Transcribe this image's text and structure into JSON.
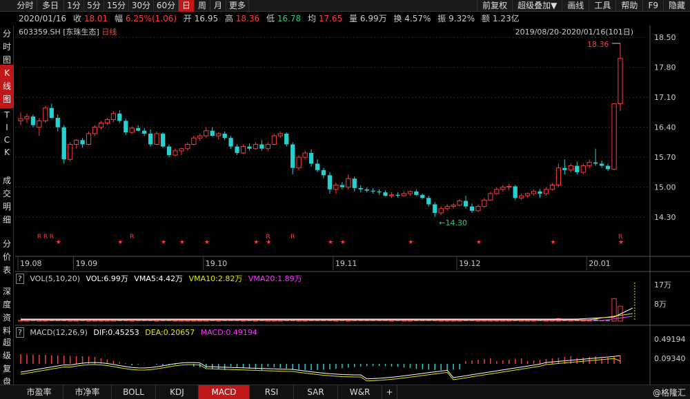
{
  "periods": [
    "分时",
    "多日",
    "1分",
    "5分",
    "15分",
    "30分",
    "60分",
    "日",
    "周",
    "月",
    "更多"
  ],
  "active_period": "日",
  "toolbar": {
    "fuquan": "前复权",
    "overlay": "超级叠加▼",
    "draw": "画线",
    "tools": "工具",
    "help": "帮助",
    "f9": "F9",
    "hide": "隐藏"
  },
  "quote": {
    "date": "2020/01/16",
    "close_label": "收",
    "close": "18.01",
    "change_label": "幅",
    "change": "6.25%(1.06)",
    "open_label": "开",
    "open": "16.95",
    "high_label": "高",
    "high": "18.36",
    "low_label": "低",
    "low": "16.78",
    "avg_label": "均",
    "avg": "17.65",
    "vol_label": "量",
    "vol": "6.99万",
    "turnover_label": "换",
    "turnover": "4.57%",
    "amplitude_label": "振",
    "amplitude": "9.32%",
    "amount_label": "额",
    "amount": "1.23亿"
  },
  "sidebar": {
    "fenshi": [
      "分",
      "时",
      "图"
    ],
    "kline": [
      "K",
      "线",
      "图"
    ],
    "tick": [
      "T",
      "I",
      "C",
      "K"
    ],
    "deal": [
      "成",
      "交",
      "明",
      "细"
    ],
    "price": [
      "分",
      "价",
      "表"
    ],
    "depth": [
      "深",
      "度",
      "资",
      "料"
    ],
    "super": [
      "超",
      "级",
      "复",
      "盘"
    ]
  },
  "code": "603359.SH",
  "name": "[东珠生态]",
  "chart_type_label": "日线",
  "date_range": "2019/08/20-2020/01/16(101日)",
  "max_label": "18.36",
  "min_label": "14.30",
  "vol_header": {
    "params": "VOL(5,10,20)",
    "vol": "VOL:6.99万",
    "vma5": "VMA5:4.42万",
    "vma10": "VMA10:2.82万",
    "vma20": "VMA20:1.89万"
  },
  "macd_header": {
    "params": "MACD(12,26,9)",
    "dif": "DIF:0.45253",
    "dea": "DEA:0.20657",
    "macd": "MACD:0.49194"
  },
  "bottom_tabs": [
    "市盈率",
    "市净率",
    "BOLL",
    "KDJ",
    "MACD",
    "RSI",
    "SAR",
    "W&R"
  ],
  "active_bottom": "MACD",
  "watermark": "@格隆汇",
  "colors": {
    "up": "#ff3b3b",
    "down": "#25d0d0",
    "bg": "#000000",
    "accent": "#c01818",
    "vma5": "#ffffff",
    "vma10": "#e6e600",
    "vma20": "#ff33ff"
  },
  "chart_data": [
    {
      "type": "candlestick",
      "title": "603359.SH [东珠生态] 日线",
      "x_tick_labels": [
        "19.08",
        "19.09",
        "19.10",
        "19.11",
        "19.12",
        "20.01"
      ],
      "y_tick_labels": [
        "18.50",
        "17.80",
        "17.10",
        "16.40",
        "15.70",
        "15.00",
        "14.30"
      ],
      "ylim": [
        13.9,
        18.6
      ],
      "annotations": {
        "high": "18.36",
        "low": "14.30"
      },
      "ohlc": [
        [
          16.55,
          16.75,
          16.45,
          16.6
        ],
        [
          16.6,
          16.72,
          16.5,
          16.65
        ],
        [
          16.65,
          16.7,
          16.4,
          16.45
        ],
        [
          16.4,
          16.62,
          16.2,
          16.55
        ],
        [
          16.55,
          16.9,
          16.5,
          16.85
        ],
        [
          16.85,
          16.95,
          16.6,
          16.62
        ],
        [
          16.62,
          16.7,
          16.3,
          16.4
        ],
        [
          16.4,
          16.45,
          15.55,
          15.65
        ],
        [
          15.65,
          16.05,
          15.6,
          16.0
        ],
        [
          16.0,
          16.12,
          15.9,
          16.1
        ],
        [
          16.1,
          16.15,
          15.92,
          16.0
        ],
        [
          16.0,
          16.3,
          15.98,
          16.25
        ],
        [
          16.25,
          16.45,
          16.2,
          16.4
        ],
        [
          16.4,
          16.55,
          16.35,
          16.5
        ],
        [
          16.5,
          16.62,
          16.45,
          16.58
        ],
        [
          16.58,
          16.78,
          16.52,
          16.72
        ],
        [
          16.72,
          16.8,
          16.5,
          16.55
        ],
        [
          16.55,
          16.6,
          16.22,
          16.28
        ],
        [
          16.28,
          16.42,
          16.25,
          16.38
        ],
        [
          16.38,
          16.45,
          16.3,
          16.32
        ],
        [
          16.32,
          16.38,
          16.2,
          16.25
        ],
        [
          16.25,
          16.35,
          15.95,
          16.0
        ],
        [
          16.0,
          16.3,
          15.98,
          16.25
        ],
        [
          16.25,
          16.28,
          15.92,
          15.95
        ],
        [
          15.95,
          16.0,
          15.7,
          15.75
        ],
        [
          15.75,
          15.9,
          15.72,
          15.85
        ],
        [
          15.85,
          15.92,
          15.75,
          15.9
        ],
        [
          15.9,
          16.05,
          15.85,
          16.0
        ],
        [
          16.0,
          16.2,
          15.98,
          16.15
        ],
        [
          16.15,
          16.25,
          16.08,
          16.2
        ],
        [
          16.2,
          16.4,
          16.15,
          16.32
        ],
        [
          16.32,
          16.4,
          16.18,
          16.2
        ],
        [
          16.2,
          16.28,
          16.12,
          16.25
        ],
        [
          16.25,
          16.3,
          16.1,
          16.15
        ],
        [
          16.15,
          16.2,
          15.9,
          15.95
        ],
        [
          15.95,
          16.0,
          15.75,
          15.8
        ],
        [
          15.8,
          16.0,
          15.78,
          15.95
        ],
        [
          15.95,
          16.02,
          15.85,
          15.9
        ],
        [
          15.9,
          16.05,
          15.88,
          16.0
        ],
        [
          16.0,
          16.1,
          15.85,
          15.9
        ],
        [
          15.9,
          16.05,
          15.85,
          16.0
        ],
        [
          16.0,
          16.25,
          15.98,
          16.2
        ],
        [
          16.2,
          16.3,
          16.15,
          16.25
        ],
        [
          16.25,
          16.28,
          15.95,
          16.0
        ],
        [
          16.0,
          16.05,
          15.3,
          15.45
        ],
        [
          15.45,
          15.75,
          15.4,
          15.7
        ],
        [
          15.7,
          15.85,
          15.65,
          15.8
        ],
        [
          15.8,
          15.88,
          15.48,
          15.55
        ],
        [
          15.55,
          15.65,
          15.35,
          15.4
        ],
        [
          15.4,
          15.45,
          15.2,
          15.28
        ],
        [
          15.28,
          15.35,
          14.85,
          14.95
        ],
        [
          14.95,
          15.1,
          14.85,
          15.05
        ],
        [
          15.05,
          15.12,
          14.95,
          15.0
        ],
        [
          15.0,
          15.3,
          14.95,
          15.2
        ],
        [
          15.2,
          15.25,
          14.9,
          14.98
        ],
        [
          14.98,
          15.05,
          14.88,
          14.95
        ],
        [
          14.95,
          15.0,
          14.88,
          14.92
        ],
        [
          14.92,
          14.98,
          14.85,
          14.9
        ],
        [
          14.9,
          14.95,
          14.82,
          14.88
        ],
        [
          14.88,
          14.92,
          14.78,
          14.8
        ],
        [
          14.8,
          14.88,
          14.75,
          14.82
        ],
        [
          14.82,
          14.88,
          14.76,
          14.8
        ],
        [
          14.8,
          14.9,
          14.78,
          14.85
        ],
        [
          14.85,
          14.92,
          14.8,
          14.9
        ],
        [
          14.9,
          14.95,
          14.8,
          14.82
        ],
        [
          14.82,
          14.85,
          14.72,
          14.75
        ],
        [
          14.75,
          14.8,
          14.55,
          14.6
        ],
        [
          14.6,
          14.65,
          14.3,
          14.4
        ],
        [
          14.4,
          14.55,
          14.35,
          14.5
        ],
        [
          14.5,
          14.6,
          14.45,
          14.55
        ],
        [
          14.55,
          14.62,
          14.5,
          14.58
        ],
        [
          14.58,
          14.72,
          14.55,
          14.68
        ],
        [
          14.68,
          14.8,
          14.5,
          14.55
        ],
        [
          14.55,
          14.62,
          14.4,
          14.45
        ],
        [
          14.45,
          14.6,
          14.42,
          14.55
        ],
        [
          14.55,
          14.75,
          14.52,
          14.7
        ],
        [
          14.7,
          14.9,
          14.68,
          14.85
        ],
        [
          14.85,
          15.0,
          14.82,
          14.95
        ],
        [
          14.95,
          15.05,
          14.9,
          15.0
        ],
        [
          15.0,
          15.08,
          14.92,
          15.02
        ],
        [
          15.02,
          15.05,
          14.7,
          14.75
        ],
        [
          14.75,
          14.85,
          14.7,
          14.8
        ],
        [
          14.8,
          14.88,
          14.75,
          14.85
        ],
        [
          14.85,
          14.95,
          14.8,
          14.9
        ],
        [
          14.9,
          14.95,
          14.75,
          14.85
        ],
        [
          14.85,
          15.0,
          14.8,
          14.95
        ],
        [
          14.95,
          15.1,
          14.92,
          15.05
        ],
        [
          15.05,
          15.55,
          15.0,
          15.45
        ],
        [
          15.45,
          15.65,
          15.3,
          15.4
        ],
        [
          15.4,
          15.55,
          15.35,
          15.5
        ],
        [
          15.5,
          15.6,
          15.3,
          15.35
        ],
        [
          15.35,
          15.55,
          15.3,
          15.5
        ],
        [
          15.5,
          15.65,
          15.45,
          15.58
        ],
        [
          15.58,
          15.9,
          15.5,
          15.55
        ],
        [
          15.55,
          15.62,
          15.45,
          15.5
        ],
        [
          15.5,
          15.55,
          15.38,
          15.42
        ],
        [
          15.42,
          16.95,
          15.4,
          16.95
        ],
        [
          16.95,
          18.36,
          16.78,
          18.01
        ]
      ]
    },
    {
      "type": "bar",
      "title": "VOL(5,10,20)",
      "y_tick_labels": [
        "17万",
        "8万"
      ],
      "ylim": [
        0,
        18
      ],
      "values": [
        0.4,
        0.3,
        0.5,
        0.4,
        0.6,
        0.5,
        0.4,
        1.1,
        0.5,
        0.4,
        0.3,
        0.4,
        0.4,
        0.5,
        0.4,
        0.6,
        0.5,
        0.5,
        0.4,
        0.3,
        0.3,
        0.5,
        0.5,
        0.4,
        0.5,
        0.4,
        0.3,
        0.4,
        0.4,
        0.3,
        0.5,
        0.4,
        0.3,
        0.3,
        0.4,
        0.5,
        0.4,
        0.3,
        0.3,
        0.4,
        0.3,
        0.4,
        0.4,
        0.4,
        0.8,
        0.5,
        0.4,
        0.4,
        0.5,
        0.4,
        0.6,
        0.4,
        0.3,
        0.5,
        0.4,
        0.3,
        0.3,
        0.3,
        0.3,
        0.3,
        0.3,
        0.3,
        0.3,
        0.3,
        0.3,
        0.3,
        0.4,
        0.6,
        0.3,
        0.3,
        0.3,
        0.3,
        0.4,
        0.4,
        0.3,
        0.3,
        0.4,
        0.4,
        0.3,
        0.3,
        0.4,
        0.3,
        0.3,
        0.3,
        0.3,
        0.3,
        0.3,
        1.2,
        0.5,
        0.4,
        0.4,
        0.4,
        0.5,
        0.8,
        0.4,
        0.4,
        10.5,
        6.99
      ]
    },
    {
      "type": "line",
      "title": "MACD(12,26,9)",
      "y_tick_labels": [
        "0.49194",
        "0.09340"
      ]
    }
  ]
}
